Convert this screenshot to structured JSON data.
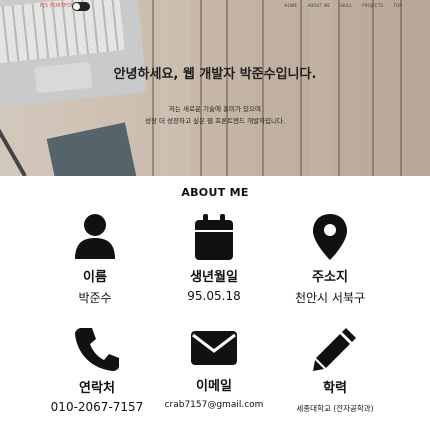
{
  "header": {
    "brand": "PJS PORTFOLIO",
    "menu": [
      "HOME",
      "ABOUT ME",
      "SKILL",
      "PROJECTS",
      "TOP"
    ]
  },
  "hero": {
    "title": "안녕하세요, 웹 개발자 박준수입니다.",
    "subtitle_line1": "저는 새로운 기술에 흥미가 있으며",
    "subtitle_line2": "성장 더 성장하고 싶은 웹 프론트엔드 개발자입니다."
  },
  "about": {
    "heading": "ABOUT ME",
    "items": [
      {
        "icon": "user-icon",
        "label": "이름",
        "value": "박준수"
      },
      {
        "icon": "calendar-icon",
        "label": "생년월일",
        "value": "95.05.18"
      },
      {
        "icon": "map-marker-icon",
        "label": "주소지",
        "value": "천안시 서북구"
      },
      {
        "icon": "phone-icon",
        "label": "연락처",
        "value": "010-2067-7157"
      },
      {
        "icon": "envelope-icon",
        "label": "이메일",
        "value": "crab7157@gmail.com"
      },
      {
        "icon": "pencil-icon",
        "label": "학력",
        "value": "세종대학교 (전자공학과)"
      }
    ]
  },
  "colors": {
    "brand": "#e24a3b",
    "text": "#111111",
    "hero_wood": "#c2b2a2"
  }
}
